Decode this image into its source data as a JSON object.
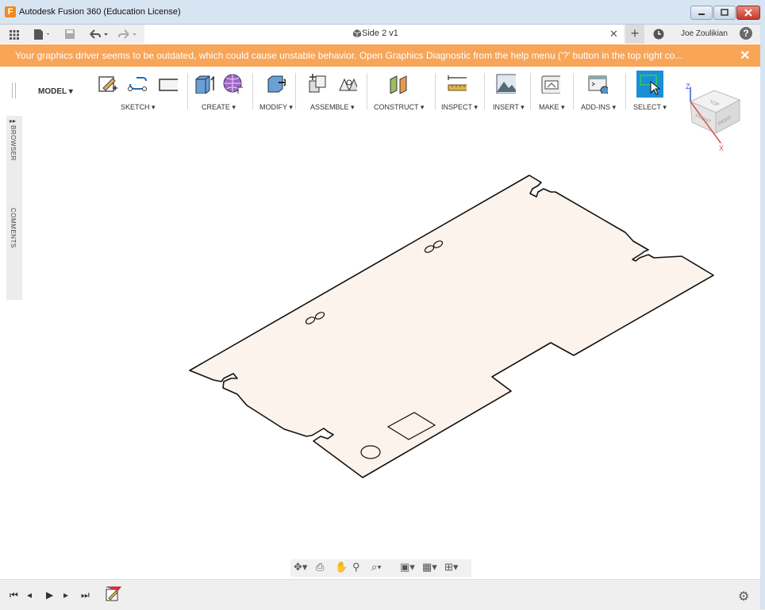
{
  "window": {
    "title": "Autodesk Fusion 360 (Education License)",
    "logo_letter": "F"
  },
  "toolbar": {
    "document_title": "Side 2 v1",
    "user_name": "Joe Zoulikian",
    "help_label": "?",
    "close_tab_label": "✕",
    "add_tab_label": "+"
  },
  "warning": {
    "text": "Your graphics driver seems to be outdated, which could cause unstable behavior. Open Graphics Diagnostic from the help menu ('?' button in the top right co...",
    "close_label": "✕"
  },
  "ribbon": {
    "workspace": "MODEL ▾",
    "groups": [
      {
        "label": "SKETCH ▾"
      },
      {
        "label": "CREATE ▾"
      },
      {
        "label": "MODIFY ▾"
      },
      {
        "label": "ASSEMBLE ▾"
      },
      {
        "label": "CONSTRUCT ▾"
      },
      {
        "label": "INSPECT ▾"
      },
      {
        "label": "INSERT ▾"
      },
      {
        "label": "MAKE ▾"
      },
      {
        "label": "ADD-INS ▾"
      },
      {
        "label": "SELECT ▾"
      }
    ]
  },
  "side_panel": {
    "browser_label": "BROWSER",
    "comments_label": "COMMENTS"
  },
  "viewcube": {
    "front": "FRONT",
    "right": "RIGHT",
    "top": "TOP",
    "z_axis": "Z",
    "x_axis": "X"
  },
  "colors": {
    "warning": "#f8a558",
    "accent_select": "#1a8fd6",
    "part_fill": "#fcf3ec",
    "part_stroke": "#111111"
  }
}
